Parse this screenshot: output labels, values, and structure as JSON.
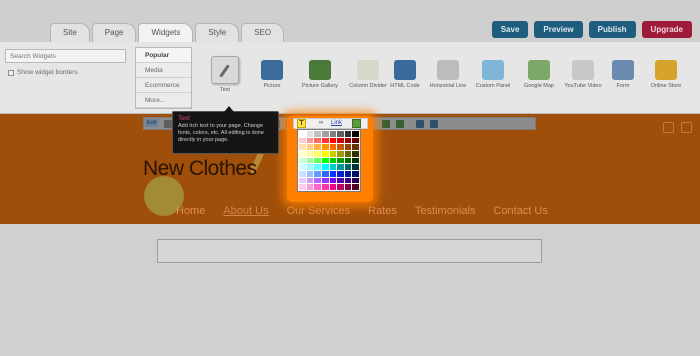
{
  "tabs": [
    {
      "label": "Site"
    },
    {
      "label": "Page"
    },
    {
      "label": "Widgets"
    },
    {
      "label": "Style"
    },
    {
      "label": "SEO"
    }
  ],
  "actions": {
    "save": "Save",
    "preview": "Preview",
    "publish": "Publish",
    "upgrade": "Upgrade"
  },
  "sidebar": {
    "search_placeholder": "Search Widgets",
    "show_borders": "Show widget borders"
  },
  "categories": [
    {
      "label": "Popular"
    },
    {
      "label": "Media"
    },
    {
      "label": "Ecommerce"
    },
    {
      "label": "More..."
    }
  ],
  "widgets": [
    {
      "label": "Text",
      "icon": "text-pen-icon",
      "color": "#d9d9d9"
    },
    {
      "label": "Picture",
      "icon": "picture-icon",
      "color": "#3b6b9a"
    },
    {
      "label": "Picture Gallery",
      "icon": "gallery-icon",
      "color": "#4a7a3a"
    },
    {
      "label": "Column Divider",
      "icon": "column-divider-icon",
      "color": "#d8d8c8"
    },
    {
      "label": "HTML Code",
      "icon": "html-code-icon",
      "color": "#3a6a9c"
    },
    {
      "label": "Horizontal Line",
      "icon": "horizontal-line-icon",
      "color": "#bcbcbc"
    },
    {
      "label": "Custom Panel",
      "icon": "custom-panel-icon",
      "color": "#7fb6d8"
    },
    {
      "label": "Google Map",
      "icon": "google-map-icon",
      "color": "#7ea86a"
    },
    {
      "label": "YouTube Video",
      "icon": "youtube-icon",
      "color": "#c8c8c8"
    },
    {
      "label": "Form",
      "icon": "form-icon",
      "color": "#6a8ab0"
    },
    {
      "label": "Online Store",
      "icon": "online-store-icon",
      "color": "#d6a32c"
    }
  ],
  "tooltip": {
    "title": "Text",
    "body": "Add rich text to your page. Change fonts, colors, etc. All editing is done directly in your page."
  },
  "site": {
    "title": "New Clothes",
    "nav": [
      {
        "label": "Home"
      },
      {
        "label": "About Us"
      },
      {
        "label": "Our Services"
      },
      {
        "label": "Rates"
      },
      {
        "label": "Testimonials"
      },
      {
        "label": "Contact Us"
      }
    ]
  },
  "toolbar": {
    "label": "Edit",
    "highlight_letter": "T",
    "link_label": "Link"
  },
  "palette": {
    "rows": [
      [
        "#ffffff",
        "#e0e0e0",
        "#c0c0c0",
        "#a0a0a0",
        "#808080",
        "#606060",
        "#303030",
        "#000000"
      ],
      [
        "#ffcccc",
        "#ff9999",
        "#ff6666",
        "#ff3333",
        "#ff0000",
        "#cc0000",
        "#990000",
        "#660000"
      ],
      [
        "#ffe0b0",
        "#ffcc80",
        "#ffb040",
        "#ff9900",
        "#ff6600",
        "#cc5500",
        "#994400",
        "#663300"
      ],
      [
        "#ffffcc",
        "#ffff99",
        "#ffff66",
        "#ffff00",
        "#cccc00",
        "#999900",
        "#666600",
        "#333300"
      ],
      [
        "#ccffcc",
        "#99ff99",
        "#66ff66",
        "#00ff00",
        "#00cc00",
        "#009900",
        "#006600",
        "#003300"
      ],
      [
        "#ccffff",
        "#99ffff",
        "#66ffff",
        "#00ffff",
        "#00cccc",
        "#009999",
        "#006666",
        "#003333"
      ],
      [
        "#cce0ff",
        "#99c2ff",
        "#6699ff",
        "#3366ff",
        "#0033ff",
        "#0022cc",
        "#001a99",
        "#001066"
      ],
      [
        "#e6ccff",
        "#cc99ff",
        "#b366ff",
        "#9933ff",
        "#7700ee",
        "#5500aa",
        "#3d007a",
        "#22004d"
      ],
      [
        "#ffccf0",
        "#ff99e0",
        "#ff66cc",
        "#ff33aa",
        "#ee0088",
        "#bb0066",
        "#880044",
        "#550022"
      ]
    ]
  }
}
